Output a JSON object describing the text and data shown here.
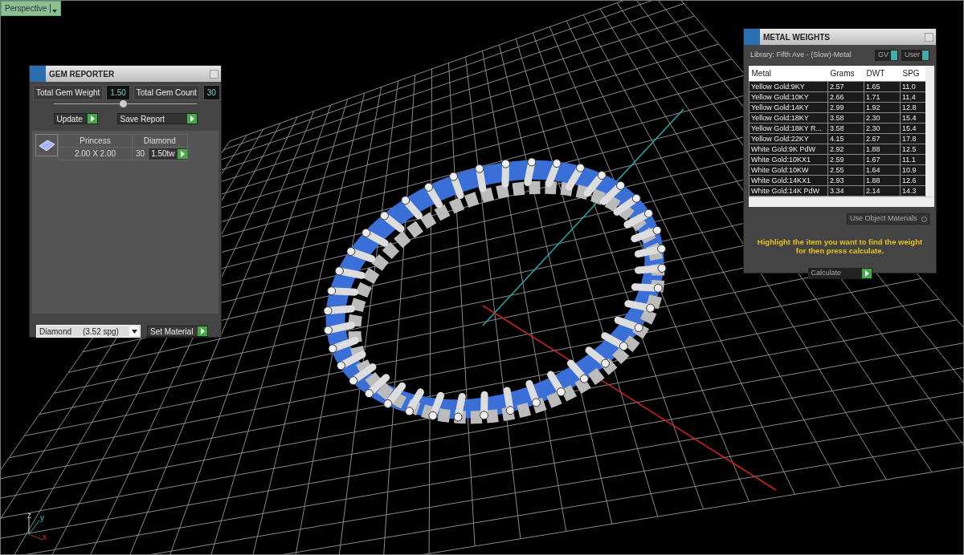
{
  "viewport": {
    "label": "Perspective",
    "axis_labels": [
      "z",
      "y",
      "x"
    ]
  },
  "gem_reporter": {
    "title": "GEM REPORTER",
    "totals": [
      {
        "label": "Total Gem Weight",
        "value": "1.50"
      },
      {
        "label": "Total Gem Count",
        "value": "30"
      }
    ],
    "buttons": [
      "Update",
      "Save Report"
    ],
    "gems": [
      {
        "shape": "Princess",
        "material": "Diamond",
        "size": "2.00 X 2.00",
        "count": "30",
        "weight": "1.50tw"
      }
    ],
    "material_select": {
      "value": "Diamond     (3.52 spg)"
    },
    "set_material_button": "Set Material"
  },
  "metal_weights": {
    "title": "METAL WEIGHTS",
    "library": "Library: Fifth Ave - (Slow)-Metal",
    "toggles": [
      {
        "label": "GV"
      },
      {
        "label": "User"
      }
    ],
    "table": {
      "columns": [
        "Metal",
        "Grams",
        "DWT",
        "SPG"
      ],
      "rows": [
        [
          "Yellow Gold:9KY",
          "2.57",
          "1.65",
          "11.0"
        ],
        [
          "Yellow Gold:10KY",
          "2.66",
          "1.71",
          "11.4"
        ],
        [
          "Yellow Gold:14KY",
          "2.99",
          "1.92",
          "12.8"
        ],
        [
          "Yellow Gold:18KY",
          "3.58",
          "2.30",
          "15.4"
        ],
        [
          "Yellow Gold:18KY R...",
          "3.58",
          "2.30",
          "15.4"
        ],
        [
          "Yellow Gold:22KY",
          "4.15",
          "2.67",
          "17.8"
        ],
        [
          "White Gold:9K PdW",
          "2.92",
          "1.88",
          "12.5"
        ],
        [
          "White Gold:10KX1",
          "2.59",
          "1.67",
          "11.1"
        ],
        [
          "White Gold:10KW",
          "2.55",
          "1.64",
          "10.9"
        ],
        [
          "White Gold:14KX1",
          "2.93",
          "1.88",
          "12.6"
        ],
        [
          "White Gold:14K PdW",
          "3.34",
          "2.14",
          "14.3"
        ]
      ]
    },
    "use_object_materials": {
      "label": "Use Object Materials"
    },
    "hint": "Highlight the item you want to find the weight for then press calculate.",
    "calculate_button": "Calculate"
  }
}
